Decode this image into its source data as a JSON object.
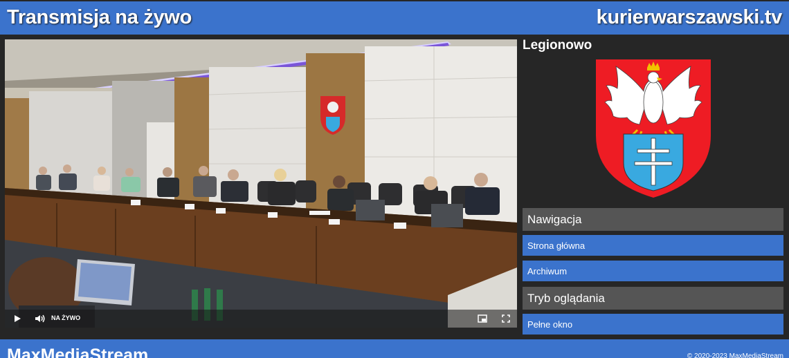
{
  "header": {
    "title": "Transmisja na żywo",
    "site": "kurierwarszawski.tv"
  },
  "player": {
    "live_label": "NA ŻYWO",
    "icons": [
      "play-icon",
      "volume-icon",
      "pip-icon",
      "fullscreen-icon"
    ]
  },
  "sidebar": {
    "city": "Legionowo",
    "sections": [
      {
        "heading": "Nawigacja",
        "links": [
          "Strona główna",
          "Archiwum"
        ]
      },
      {
        "heading": "Tryb oglądania",
        "links": [
          "Pełne okno"
        ]
      }
    ]
  },
  "footer": {
    "brand": "MaxMediaStream",
    "copyright": "© 2020-2023 MaxMediaStream"
  },
  "colors": {
    "accent": "#3b73cc",
    "background": "#262626",
    "section_heading": "#555555",
    "crest_red": "#ee1c24",
    "crest_blue": "#39a9e0"
  }
}
